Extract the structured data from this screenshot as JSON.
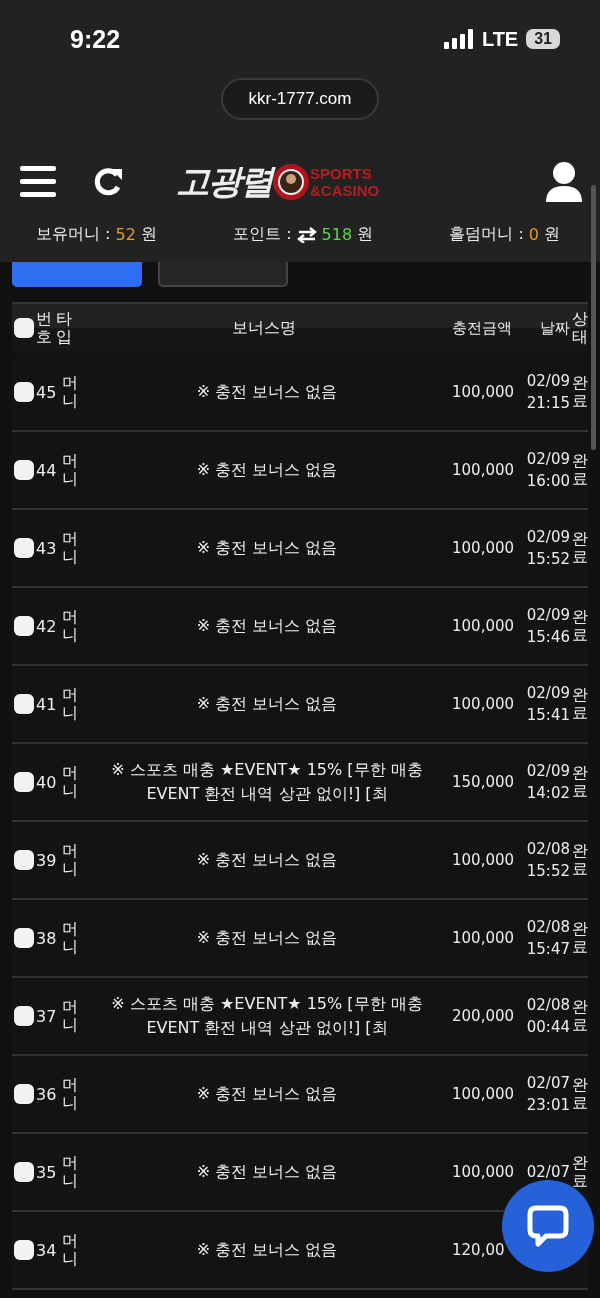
{
  "status_bar": {
    "time": "9:22",
    "network": "LTE",
    "battery": "31"
  },
  "address_bar": {
    "url": "kkr-1777.com"
  },
  "header": {
    "logo_text": "고광렬",
    "logo_sub": [
      "SPORTS",
      "&CASINO"
    ]
  },
  "balances": [
    {
      "label": "보유머니 :",
      "value": "52",
      "unit": "원",
      "kind": "money"
    },
    {
      "label": "포인트 :",
      "value": "518",
      "unit": "원",
      "kind": "point"
    },
    {
      "label": "홀덤머니 :",
      "value": "0",
      "unit": "원",
      "kind": "money"
    }
  ],
  "tabs": [
    {
      "selected": true
    },
    {
      "selected": false
    }
  ],
  "table": {
    "header_checked": false,
    "columns": [
      "번호",
      "타입",
      "보너스명",
      "충전금액",
      "날짜",
      "상태"
    ],
    "rows": [
      {
        "checked": false,
        "number": "45",
        "type": "머니",
        "bonus": "※ 충전 보너스 없음",
        "amount": "100,000",
        "date": "02/09",
        "time": "21:15",
        "status": "완료"
      },
      {
        "checked": false,
        "number": "44",
        "type": "머니",
        "bonus": "※ 충전 보너스 없음",
        "amount": "100,000",
        "date": "02/09",
        "time": "16:00",
        "status": "완료"
      },
      {
        "checked": false,
        "number": "43",
        "type": "머니",
        "bonus": "※ 충전 보너스 없음",
        "amount": "100,000",
        "date": "02/09",
        "time": "15:52",
        "status": "완료"
      },
      {
        "checked": false,
        "number": "42",
        "type": "머니",
        "bonus": "※ 충전 보너스 없음",
        "amount": "100,000",
        "date": "02/09",
        "time": "15:46",
        "status": "완료"
      },
      {
        "checked": false,
        "number": "41",
        "type": "머니",
        "bonus": "※ 충전 보너스 없음",
        "amount": "100,000",
        "date": "02/09",
        "time": "15:41",
        "status": "완료"
      },
      {
        "checked": false,
        "number": "40",
        "type": "머니",
        "bonus": "※ 스포츠 매충 ★EVENT★ 15% [무한 매충 EVENT 환전 내역 상관 없이!] [최",
        "amount": "150,000",
        "date": "02/09",
        "time": "14:02",
        "status": "완료"
      },
      {
        "checked": false,
        "number": "39",
        "type": "머니",
        "bonus": "※ 충전 보너스 없음",
        "amount": "100,000",
        "date": "02/08",
        "time": "15:52",
        "status": "완료"
      },
      {
        "checked": false,
        "number": "38",
        "type": "머니",
        "bonus": "※ 충전 보너스 없음",
        "amount": "100,000",
        "date": "02/08",
        "time": "15:47",
        "status": "완료"
      },
      {
        "checked": false,
        "number": "37",
        "type": "머니",
        "bonus": "※ 스포츠 매충 ★EVENT★ 15% [무한 매충 EVENT 환전 내역 상관 없이!] [최",
        "amount": "200,000",
        "date": "02/08",
        "time": "00:44",
        "status": "완료"
      },
      {
        "checked": false,
        "number": "36",
        "type": "머니",
        "bonus": "※ 충전 보너스 없음",
        "amount": "100,000",
        "date": "02/07",
        "time": "23:01",
        "status": "완료"
      },
      {
        "checked": false,
        "number": "35",
        "type": "머니",
        "bonus": "※ 충전 보너스 없음",
        "amount": "100,000",
        "date": "02/07",
        "status": "완료"
      },
      {
        "checked": false,
        "number": "34",
        "type": "머니",
        "bonus": "※ 충전 보너스 없음",
        "amount": "120,00"
      }
    ]
  }
}
